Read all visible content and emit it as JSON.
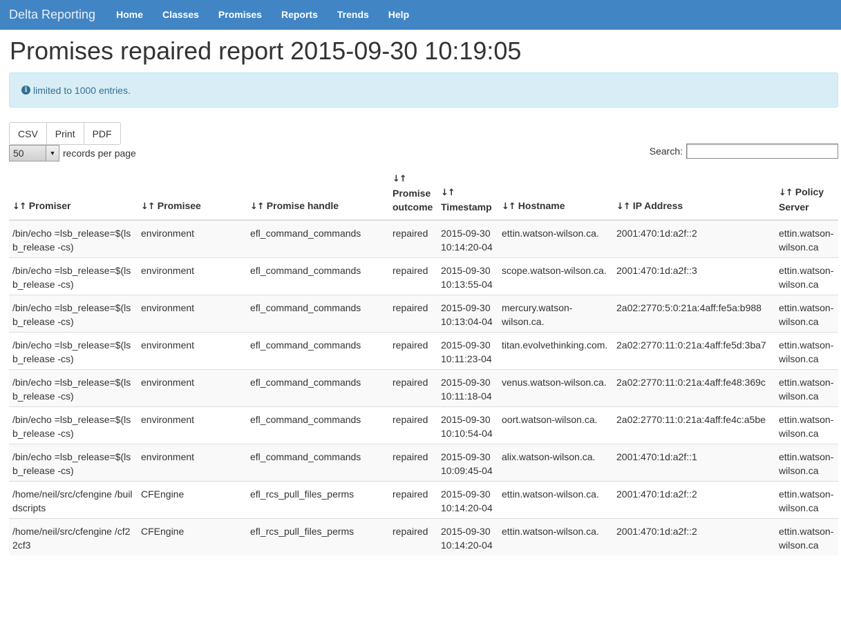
{
  "nav": {
    "brand": "Delta Reporting",
    "items": [
      "Home",
      "Classes",
      "Promises",
      "Reports",
      "Trends",
      "Help"
    ]
  },
  "page": {
    "title": "Promises repaired report 2015-09-30 10:19:05",
    "alert": "limited to 1000 entries."
  },
  "toolbar": {
    "csv": "CSV",
    "print": "Print",
    "pdf": "PDF",
    "page_length": "50",
    "page_length_label": "records per page",
    "search_label": "Search:",
    "search_value": ""
  },
  "table": {
    "headers": [
      "Promiser",
      "Promisee",
      "Promise handle",
      "Promise outcome",
      "Timestamp",
      "Hostname",
      "IP Address",
      "Policy Server"
    ],
    "rows": [
      [
        "/bin/echo =lsb_release=$(lsb_release -cs)",
        "environment",
        "efl_command_commands",
        "repaired",
        "2015-09-30 10:14:20-04",
        "ettin.watson-wilson.ca.",
        "2001:470:1d:a2f::2",
        "ettin.watson-wilson.ca"
      ],
      [
        "/bin/echo =lsb_release=$(lsb_release -cs)",
        "environment",
        "efl_command_commands",
        "repaired",
        "2015-09-30 10:13:55-04",
        "scope.watson-wilson.ca.",
        "2001:470:1d:a2f::3",
        "ettin.watson-wilson.ca"
      ],
      [
        "/bin/echo =lsb_release=$(lsb_release -cs)",
        "environment",
        "efl_command_commands",
        "repaired",
        "2015-09-30 10:13:04-04",
        "mercury.watson-wilson.ca.",
        "2a02:2770:5:0:21a:4aff:fe5a:b988",
        "ettin.watson-wilson.ca"
      ],
      [
        "/bin/echo =lsb_release=$(lsb_release -cs)",
        "environment",
        "efl_command_commands",
        "repaired",
        "2015-09-30 10:11:23-04",
        "titan.evolvethinking.com.",
        "2a02:2770:11:0:21a:4aff:fe5d:3ba7",
        "ettin.watson-wilson.ca"
      ],
      [
        "/bin/echo =lsb_release=$(lsb_release -cs)",
        "environment",
        "efl_command_commands",
        "repaired",
        "2015-09-30 10:11:18-04",
        "venus.watson-wilson.ca.",
        "2a02:2770:11:0:21a:4aff:fe48:369c",
        "ettin.watson-wilson.ca"
      ],
      [
        "/bin/echo =lsb_release=$(lsb_release -cs)",
        "environment",
        "efl_command_commands",
        "repaired",
        "2015-09-30 10:10:54-04",
        "oort.watson-wilson.ca.",
        "2a02:2770:11:0:21a:4aff:fe4c:a5be",
        "ettin.watson-wilson.ca"
      ],
      [
        "/bin/echo =lsb_release=$(lsb_release -cs)",
        "environment",
        "efl_command_commands",
        "repaired",
        "2015-09-30 10:09:45-04",
        "alix.watson-wilson.ca.",
        "2001:470:1d:a2f::1",
        "ettin.watson-wilson.ca"
      ],
      [
        "/home/neil/src/cfengine /buildscripts",
        "CFEngine",
        "efl_rcs_pull_files_perms",
        "repaired",
        "2015-09-30 10:14:20-04",
        "ettin.watson-wilson.ca.",
        "2001:470:1d:a2f::2",
        "ettin.watson-wilson.ca"
      ],
      [
        "/home/neil/src/cfengine /cf22cf3",
        "CFEngine",
        "efl_rcs_pull_files_perms",
        "repaired",
        "2015-09-30 10:14:20-04",
        "ettin.watson-wilson.ca.",
        "2001:470:1d:a2f::2",
        "ettin.watson-wilson.ca"
      ]
    ]
  }
}
